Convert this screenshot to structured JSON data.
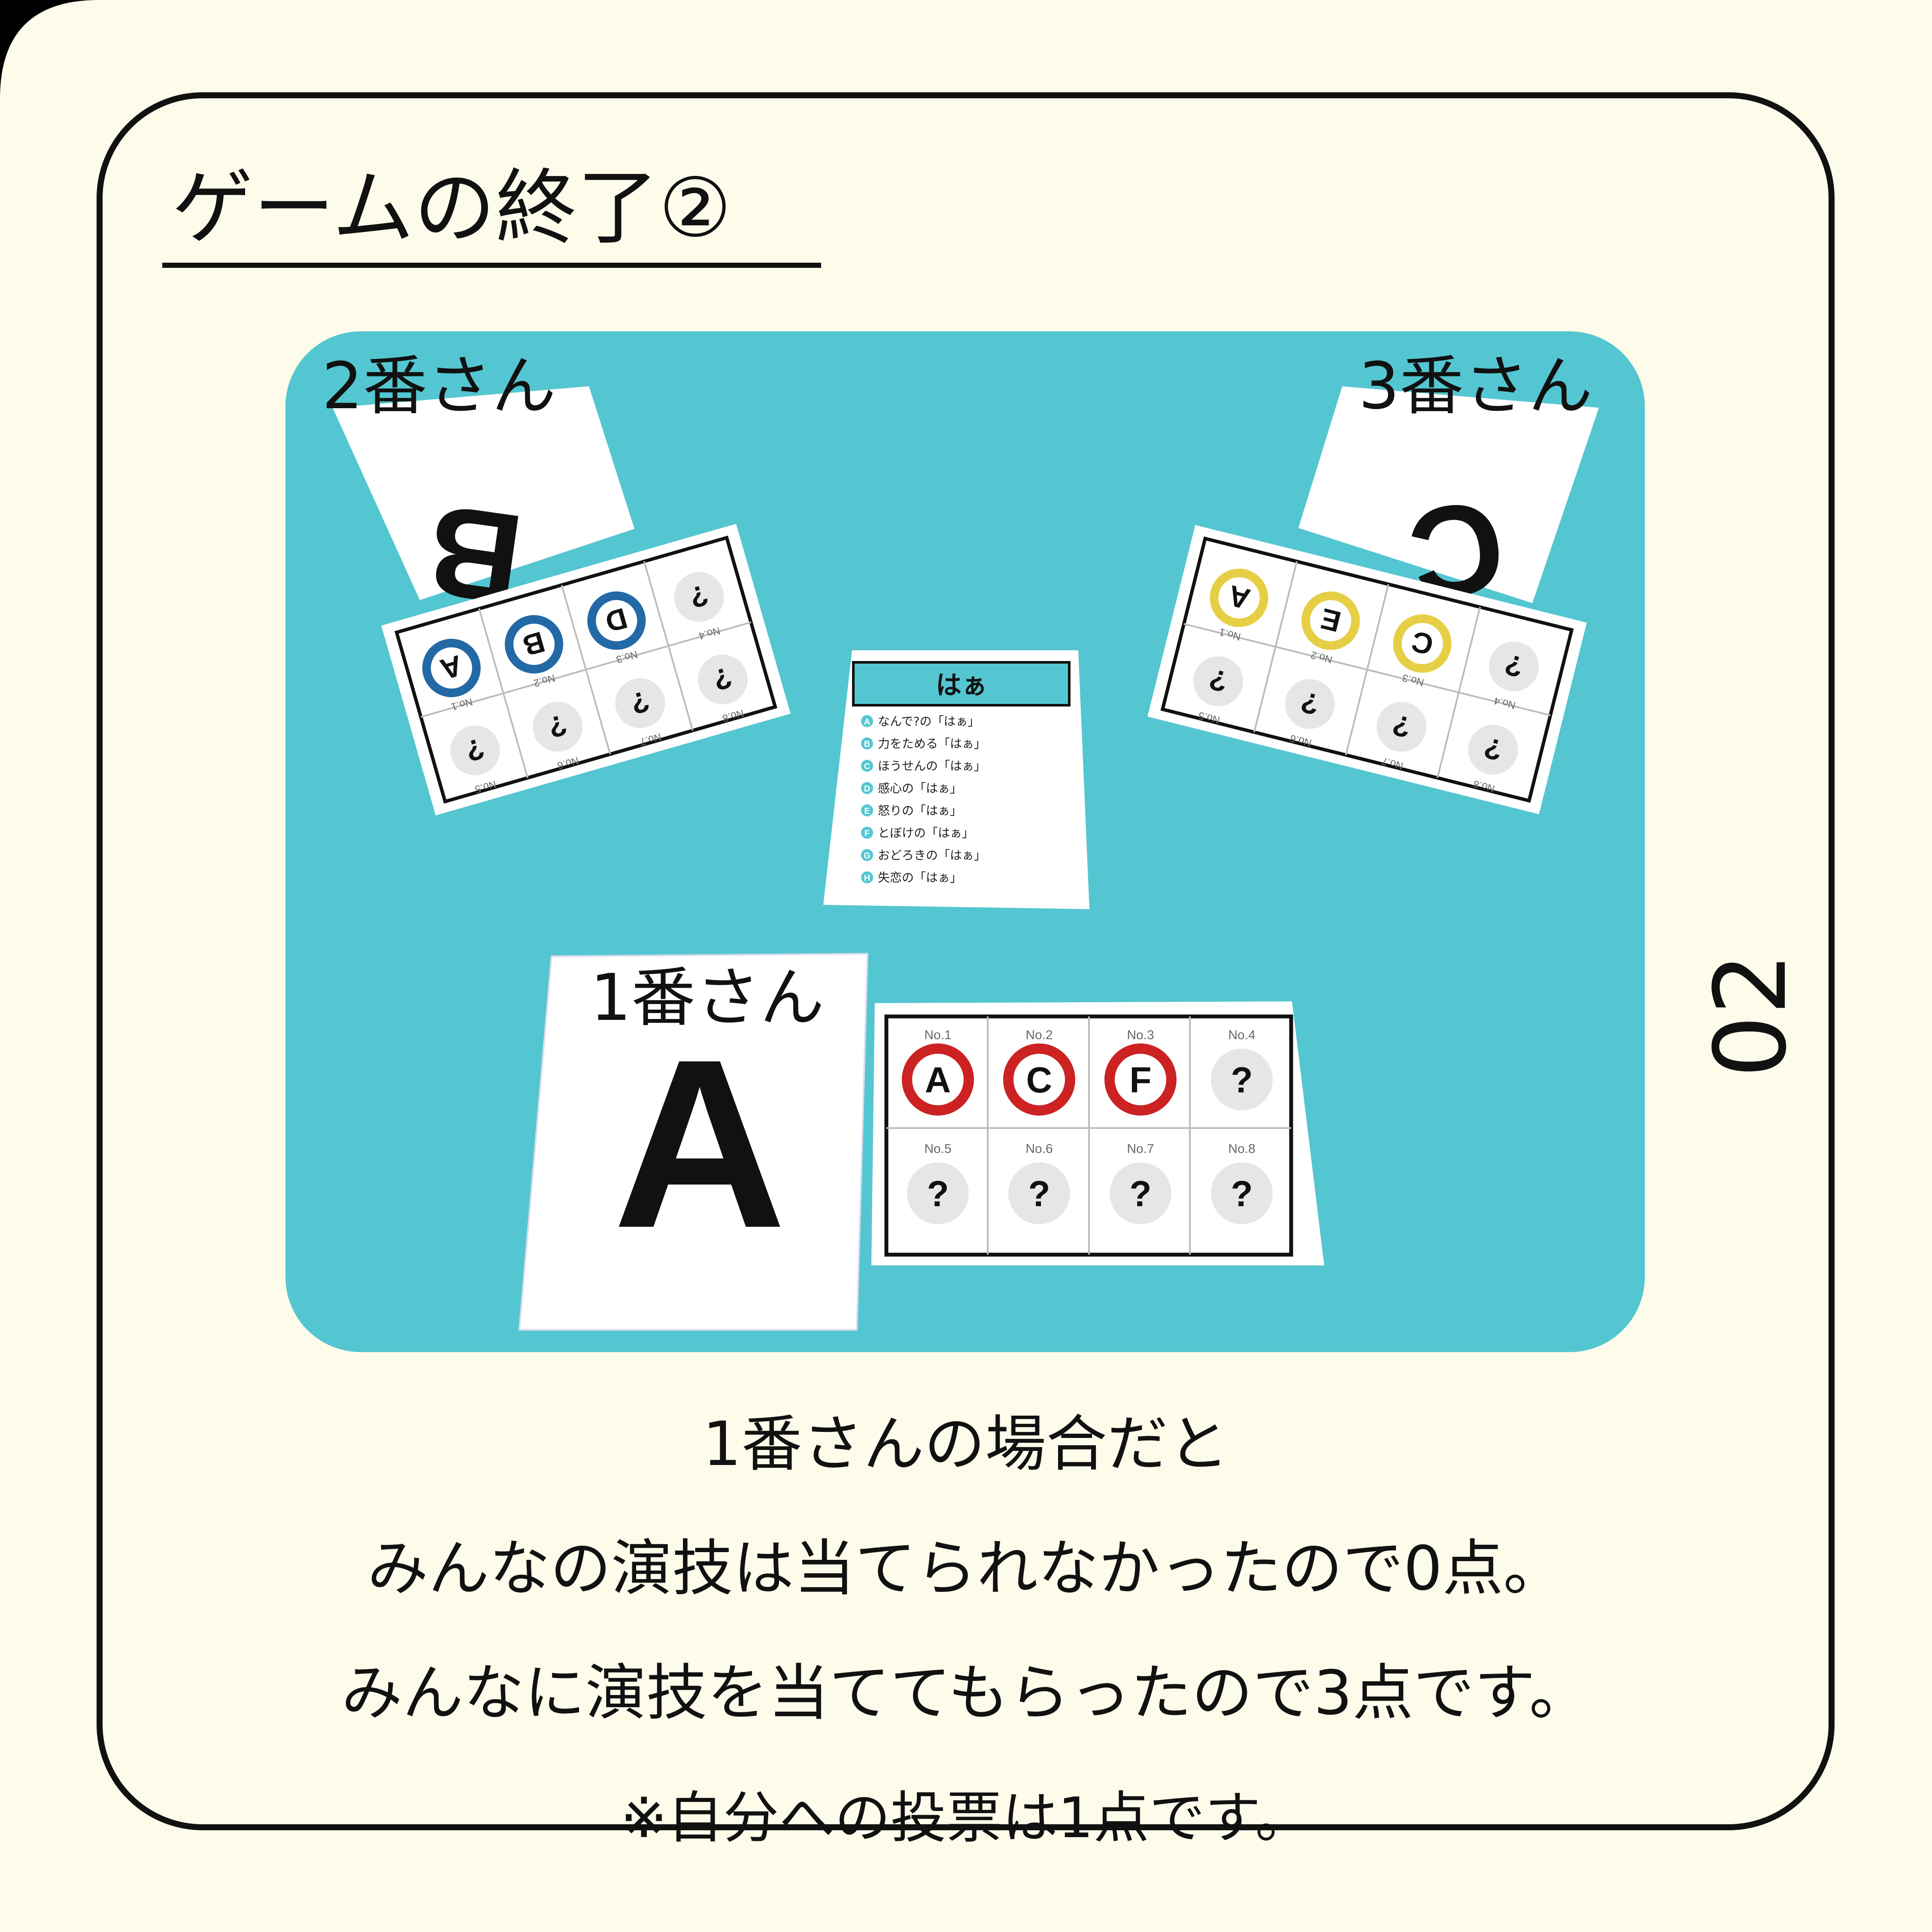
{
  "page": {
    "title": "ゲームの終了②",
    "page_number": "02",
    "colors": {
      "background": "#fdfbea",
      "table": "#54c6d1",
      "frame": "#111111",
      "card": "#ffffff",
      "p1_mark": "#cc2222",
      "p2_mark": "#2369a6",
      "p3_mark": "#e6cf45"
    }
  },
  "players": [
    {
      "label": "1番さん",
      "letter": "A"
    },
    {
      "label": "2番さん",
      "letter": "B"
    },
    {
      "label": "3番さん",
      "letter": "C"
    }
  ],
  "score_sheets": {
    "p1": [
      {
        "no": "No.1",
        "mark": "A"
      },
      {
        "no": "No.2",
        "mark": "C"
      },
      {
        "no": "No.3",
        "mark": "F"
      },
      {
        "no": "No.4",
        "mark": "?"
      },
      {
        "no": "No.5",
        "mark": "?"
      },
      {
        "no": "No.6",
        "mark": "?"
      },
      {
        "no": "No.7",
        "mark": "?"
      },
      {
        "no": "No.8",
        "mark": "?"
      }
    ],
    "p2": [
      {
        "no": "No.1",
        "mark": "A"
      },
      {
        "no": "No.2",
        "mark": "B"
      },
      {
        "no": "No.3",
        "mark": "D"
      },
      {
        "no": "No.4",
        "mark": "?"
      },
      {
        "no": "No.5",
        "mark": "?"
      },
      {
        "no": "No.6",
        "mark": "?"
      },
      {
        "no": "No.7",
        "mark": "?"
      },
      {
        "no": "No.8",
        "mark": "?"
      }
    ],
    "p3": [
      {
        "no": "No.1",
        "mark": "A"
      },
      {
        "no": "No.2",
        "mark": "E"
      },
      {
        "no": "No.3",
        "mark": "C"
      },
      {
        "no": "No.4",
        "mark": "?"
      },
      {
        "no": "No.5",
        "mark": "?"
      },
      {
        "no": "No.6",
        "mark": "?"
      },
      {
        "no": "No.7",
        "mark": "?"
      },
      {
        "no": "No.8",
        "mark": "?"
      }
    ]
  },
  "theme_card": {
    "title": "はぁ",
    "items": [
      {
        "key": "A",
        "text": "なんで?の「はぁ」"
      },
      {
        "key": "B",
        "text": "力をためる「はぁ」"
      },
      {
        "key": "C",
        "text": "ほうせんの「はぁ」"
      },
      {
        "key": "D",
        "text": "感心の「はぁ」"
      },
      {
        "key": "E",
        "text": "怒りの「はぁ」"
      },
      {
        "key": "F",
        "text": "とぼけの「はぁ」"
      },
      {
        "key": "G",
        "text": "おどろきの「はぁ」"
      },
      {
        "key": "H",
        "text": "失恋の「はぁ」"
      }
    ]
  },
  "caption": [
    "1番さんの場合だと",
    "みんなの演技は当てられなかったので0点。",
    "みんなに演技を当ててもらったので3点です。",
    "※自分への投票は1点です。"
  ]
}
